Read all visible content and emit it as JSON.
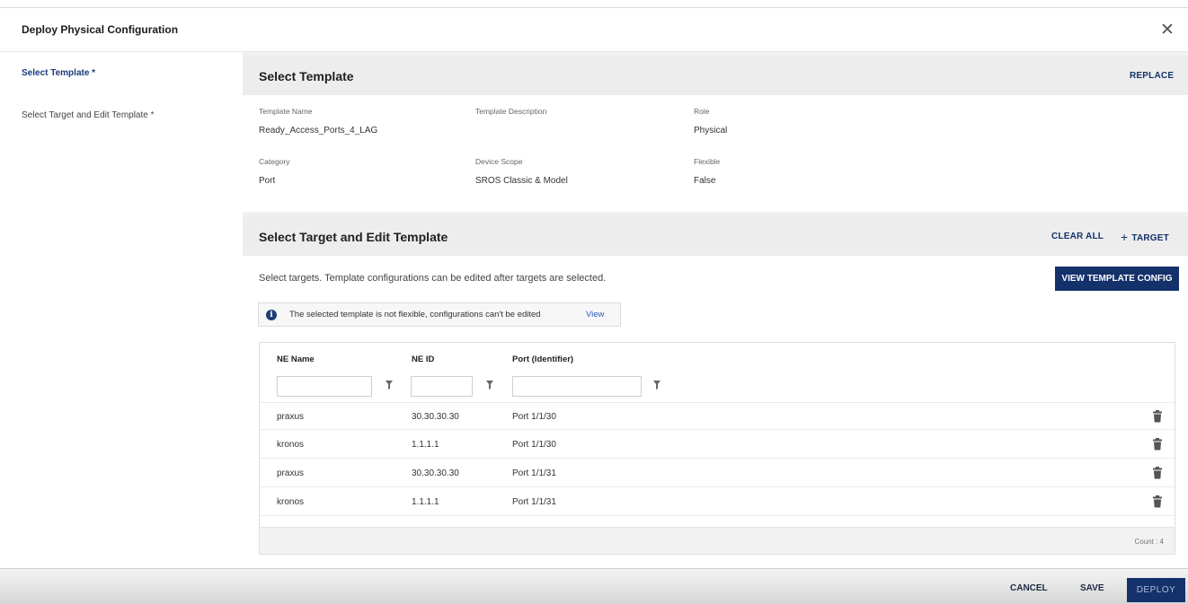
{
  "dialog": {
    "title": "Deploy Physical Configuration",
    "close_icon": "close-icon"
  },
  "nav": {
    "items": [
      {
        "label": "Select Template *",
        "active": true
      },
      {
        "label": "Select Target and Edit Template *",
        "active": false
      }
    ]
  },
  "select_template": {
    "title": "Select Template",
    "replace_label": "REPLACE",
    "fields": {
      "template_name": {
        "label": "Template Name",
        "value": "Ready_Access_Ports_4_LAG"
      },
      "template_description": {
        "label": "Template Description",
        "value": ""
      },
      "role": {
        "label": "Role",
        "value": "Physical"
      },
      "category": {
        "label": "Category",
        "value": "Port"
      },
      "device_scope": {
        "label": "Device Scope",
        "value": "SROS Classic & Model"
      },
      "flexible": {
        "label": "Flexible",
        "value": "False"
      }
    }
  },
  "select_target": {
    "title": "Select Target and Edit Template",
    "clear_all_label": "CLEAR ALL",
    "add_target_label": "TARGET",
    "hint": "Select targets. Template configurations can be edited after targets are selected.",
    "view_config_label": "VIEW TEMPLATE CONFIG",
    "info": {
      "text": "The selected template is not flexible, configurations can't be edited",
      "link": "View"
    },
    "table": {
      "columns": [
        "NE Name",
        "NE ID",
        "Port (Identifier)"
      ],
      "filters": {
        "ne_name": "",
        "ne_id": "",
        "port": ""
      },
      "rows": [
        {
          "ne_name": "praxus",
          "ne_id": "30.30.30.30",
          "port": "Port 1/1/30"
        },
        {
          "ne_name": "kronos",
          "ne_id": "1.1.1.1",
          "port": "Port 1/1/30"
        },
        {
          "ne_name": "praxus",
          "ne_id": "30.30.30.30",
          "port": "Port 1/1/31"
        },
        {
          "ne_name": "kronos",
          "ne_id": "1.1.1.1",
          "port": "Port 1/1/31"
        }
      ],
      "count_text": "Count : 4"
    }
  },
  "footer": {
    "cancel_label": "CANCEL",
    "save_label": "SAVE",
    "deploy_label": "DEPLOY"
  },
  "colors": {
    "accent": "#15316b",
    "link": "#2c5bb6",
    "section_header": "#ededed"
  }
}
